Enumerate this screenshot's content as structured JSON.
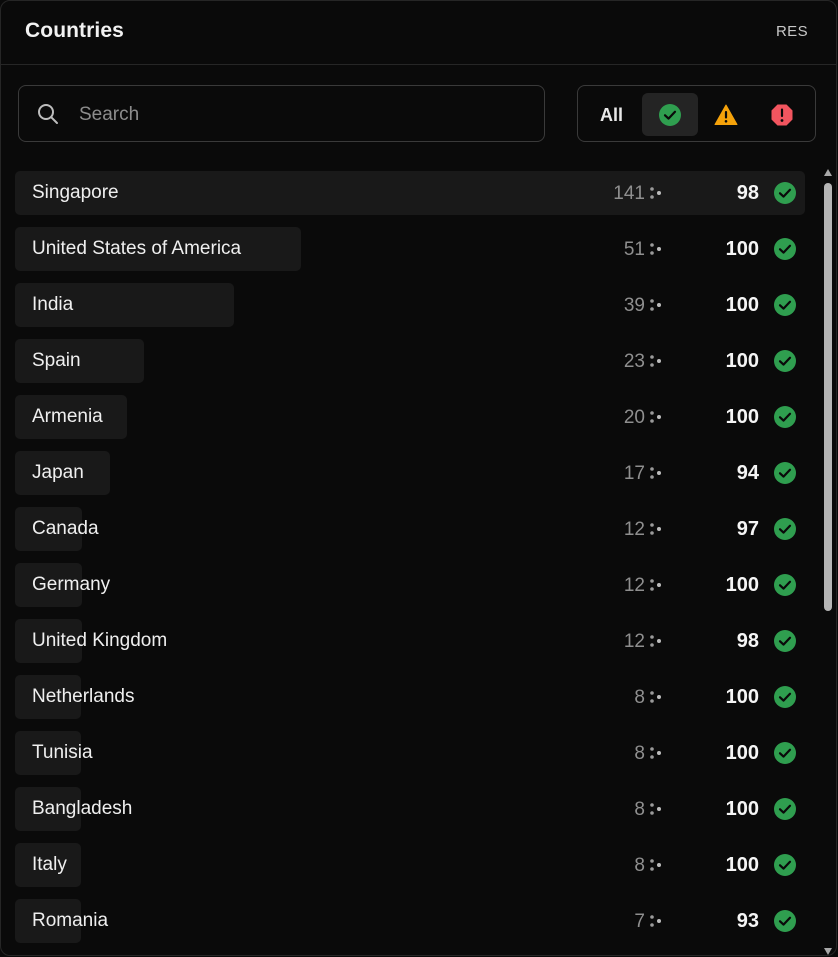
{
  "header": {
    "title": "Countries",
    "badge": "RES"
  },
  "search": {
    "placeholder": "Search",
    "value": ""
  },
  "filters": {
    "all_label": "All",
    "items": [
      {
        "id": "ok",
        "icon": "check-circle-icon",
        "color": "#2f9e4f"
      },
      {
        "id": "warning",
        "icon": "warning-triangle-icon",
        "color": "#f5a20a"
      },
      {
        "id": "error",
        "icon": "error-octagon-icon",
        "color": "#f2555f"
      }
    ],
    "active": "ok"
  },
  "colors": {
    "background": "#0a0a0a",
    "bar": "#191919",
    "ok": "#2f9e4f"
  },
  "countries": [
    {
      "name": "Singapore",
      "count": "141",
      "score": "98",
      "status": "ok",
      "share": 1.0
    },
    {
      "name": "United States of America",
      "count": "51",
      "score": "100",
      "status": "ok",
      "share": 0.362
    },
    {
      "name": "India",
      "count": "39",
      "score": "100",
      "status": "ok",
      "share": 0.277
    },
    {
      "name": "Spain",
      "count": "23",
      "score": "100",
      "status": "ok",
      "share": 0.163
    },
    {
      "name": "Armenia",
      "count": "20",
      "score": "100",
      "status": "ok",
      "share": 0.142
    },
    {
      "name": "Japan",
      "count": "17",
      "score": "94",
      "status": "ok",
      "share": 0.12
    },
    {
      "name": "Canada",
      "count": "12",
      "score": "97",
      "status": "ok",
      "share": 0.085
    },
    {
      "name": "Germany",
      "count": "12",
      "score": "100",
      "status": "ok",
      "share": 0.085
    },
    {
      "name": "United Kingdom",
      "count": "12",
      "score": "98",
      "status": "ok",
      "share": 0.085
    },
    {
      "name": "Netherlands",
      "count": "8",
      "score": "100",
      "status": "ok",
      "share": 0.057
    },
    {
      "name": "Tunisia",
      "count": "8",
      "score": "100",
      "status": "ok",
      "share": 0.057
    },
    {
      "name": "Bangladesh",
      "count": "8",
      "score": "100",
      "status": "ok",
      "share": 0.057
    },
    {
      "name": "Italy",
      "count": "8",
      "score": "100",
      "status": "ok",
      "share": 0.057
    },
    {
      "name": "Romania",
      "count": "7",
      "score": "93",
      "status": "ok",
      "share": 0.05
    }
  ]
}
